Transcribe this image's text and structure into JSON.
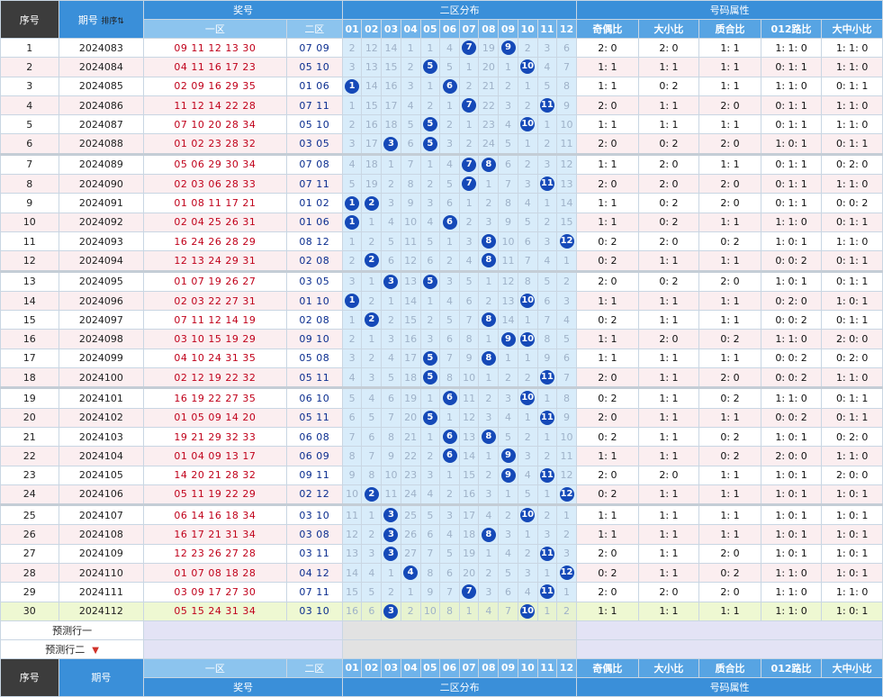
{
  "headers": {
    "seq": "序号",
    "period": "期号",
    "sort_icon_label": "排序",
    "prize": "奖号",
    "zone1": "一区",
    "zone2": "二区",
    "distribution": "二区分布",
    "attributes": "号码属性",
    "cols": [
      "01",
      "02",
      "03",
      "04",
      "05",
      "06",
      "07",
      "08",
      "09",
      "10",
      "11",
      "12"
    ],
    "attr_names": [
      "奇偶比",
      "大小比",
      "质合比",
      "012路比",
      "大中小比"
    ]
  },
  "rows": [
    {
      "seq": "1",
      "period": "2024083",
      "z1": "09 11 12 13 30",
      "z2": "07 09",
      "dist": [
        "2",
        "12",
        "14",
        "1",
        "1",
        "4",
        "07",
        "19",
        "09",
        "2",
        "3",
        "6"
      ],
      "attrs": [
        "2: 0",
        "2: 0",
        "1: 1",
        "1: 1: 0",
        "1: 1: 0"
      ]
    },
    {
      "seq": "2",
      "period": "2024084",
      "z1": "04 11 16 17 23",
      "z2": "05 10",
      "dist": [
        "3",
        "13",
        "15",
        "2",
        "05",
        "5",
        "1",
        "20",
        "1",
        "10",
        "4",
        "7"
      ],
      "attrs": [
        "1: 1",
        "1: 1",
        "1: 1",
        "0: 1: 1",
        "1: 1: 0"
      ]
    },
    {
      "seq": "3",
      "period": "2024085",
      "z1": "02 09 16 29 35",
      "z2": "01 06",
      "dist": [
        "01",
        "14",
        "16",
        "3",
        "1",
        "06",
        "2",
        "21",
        "2",
        "1",
        "5",
        "8"
      ],
      "attrs": [
        "1: 1",
        "0: 2",
        "1: 1",
        "1: 1: 0",
        "0: 1: 1"
      ]
    },
    {
      "seq": "4",
      "period": "2024086",
      "z1": "11 12 14 22 28",
      "z2": "07 11",
      "dist": [
        "1",
        "15",
        "17",
        "4",
        "2",
        "1",
        "07",
        "22",
        "3",
        "2",
        "11",
        "9"
      ],
      "attrs": [
        "2: 0",
        "1: 1",
        "2: 0",
        "0: 1: 1",
        "1: 1: 0"
      ]
    },
    {
      "seq": "5",
      "period": "2024087",
      "z1": "07 10 20 28 34",
      "z2": "05 10",
      "dist": [
        "2",
        "16",
        "18",
        "5",
        "05",
        "2",
        "1",
        "23",
        "4",
        "10",
        "1",
        "10"
      ],
      "attrs": [
        "1: 1",
        "1: 1",
        "1: 1",
        "0: 1: 1",
        "1: 1: 0"
      ]
    },
    {
      "seq": "6",
      "period": "2024088",
      "z1": "01 02 23 28 32",
      "z2": "03 05",
      "dist": [
        "3",
        "17",
        "03",
        "6",
        "05",
        "3",
        "2",
        "24",
        "5",
        "1",
        "2",
        "11"
      ],
      "attrs": [
        "2: 0",
        "0: 2",
        "2: 0",
        "1: 0: 1",
        "0: 1: 1"
      ]
    },
    {
      "seq": "7",
      "period": "2024089",
      "z1": "05 06 29 30 34",
      "z2": "07 08",
      "dist": [
        "4",
        "18",
        "1",
        "7",
        "1",
        "4",
        "07",
        "08",
        "6",
        "2",
        "3",
        "12"
      ],
      "attrs": [
        "1: 1",
        "2: 0",
        "1: 1",
        "0: 1: 1",
        "0: 2: 0"
      ]
    },
    {
      "seq": "8",
      "period": "2024090",
      "z1": "02 03 06 28 33",
      "z2": "07 11",
      "dist": [
        "5",
        "19",
        "2",
        "8",
        "2",
        "5",
        "07",
        "1",
        "7",
        "3",
        "11",
        "13"
      ],
      "attrs": [
        "2: 0",
        "2: 0",
        "2: 0",
        "0: 1: 1",
        "1: 1: 0"
      ]
    },
    {
      "seq": "9",
      "period": "2024091",
      "z1": "01 08 11 17 21",
      "z2": "01 02",
      "dist": [
        "01",
        "02",
        "3",
        "9",
        "3",
        "6",
        "1",
        "2",
        "8",
        "4",
        "1",
        "14"
      ],
      "attrs": [
        "1: 1",
        "0: 2",
        "2: 0",
        "0: 1: 1",
        "0: 0: 2"
      ]
    },
    {
      "seq": "10",
      "period": "2024092",
      "z1": "02 04 25 26 31",
      "z2": "01 06",
      "dist": [
        "01",
        "1",
        "4",
        "10",
        "4",
        "06",
        "2",
        "3",
        "9",
        "5",
        "2",
        "15"
      ],
      "attrs": [
        "1: 1",
        "0: 2",
        "1: 1",
        "1: 1: 0",
        "0: 1: 1"
      ]
    },
    {
      "seq": "11",
      "period": "2024093",
      "z1": "16 24 26 28 29",
      "z2": "08 12",
      "dist": [
        "1",
        "2",
        "5",
        "11",
        "5",
        "1",
        "3",
        "08",
        "10",
        "6",
        "3",
        "12"
      ],
      "attrs": [
        "0: 2",
        "2: 0",
        "0: 2",
        "1: 0: 1",
        "1: 1: 0"
      ]
    },
    {
      "seq": "12",
      "period": "2024094",
      "z1": "12 13 24 29 31",
      "z2": "02 08",
      "dist": [
        "2",
        "02",
        "6",
        "12",
        "6",
        "2",
        "4",
        "08",
        "11",
        "7",
        "4",
        "1"
      ],
      "attrs": [
        "0: 2",
        "1: 1",
        "1: 1",
        "0: 0: 2",
        "0: 1: 1"
      ]
    },
    {
      "seq": "13",
      "period": "2024095",
      "z1": "01 07 19 26 27",
      "z2": "03 05",
      "dist": [
        "3",
        "1",
        "03",
        "13",
        "05",
        "3",
        "5",
        "1",
        "12",
        "8",
        "5",
        "2"
      ],
      "attrs": [
        "2: 0",
        "0: 2",
        "2: 0",
        "1: 0: 1",
        "0: 1: 1"
      ]
    },
    {
      "seq": "14",
      "period": "2024096",
      "z1": "02 03 22 27 31",
      "z2": "01 10",
      "dist": [
        "01",
        "2",
        "1",
        "14",
        "1",
        "4",
        "6",
        "2",
        "13",
        "10",
        "6",
        "3"
      ],
      "attrs": [
        "1: 1",
        "1: 1",
        "1: 1",
        "0: 2: 0",
        "1: 0: 1"
      ]
    },
    {
      "seq": "15",
      "period": "2024097",
      "z1": "07 11 12 14 19",
      "z2": "02 08",
      "dist": [
        "1",
        "02",
        "2",
        "15",
        "2",
        "5",
        "7",
        "08",
        "14",
        "1",
        "7",
        "4"
      ],
      "attrs": [
        "0: 2",
        "1: 1",
        "1: 1",
        "0: 0: 2",
        "0: 1: 1"
      ]
    },
    {
      "seq": "16",
      "period": "2024098",
      "z1": "03 10 15 19 29",
      "z2": "09 10",
      "dist": [
        "2",
        "1",
        "3",
        "16",
        "3",
        "6",
        "8",
        "1",
        "09",
        "10",
        "8",
        "5"
      ],
      "attrs": [
        "1: 1",
        "2: 0",
        "0: 2",
        "1: 1: 0",
        "2: 0: 0"
      ]
    },
    {
      "seq": "17",
      "period": "2024099",
      "z1": "04 10 24 31 35",
      "z2": "05 08",
      "dist": [
        "3",
        "2",
        "4",
        "17",
        "05",
        "7",
        "9",
        "08",
        "1",
        "1",
        "9",
        "6"
      ],
      "attrs": [
        "1: 1",
        "1: 1",
        "1: 1",
        "0: 0: 2",
        "0: 2: 0"
      ]
    },
    {
      "seq": "18",
      "period": "2024100",
      "z1": "02 12 19 22 32",
      "z2": "05 11",
      "dist": [
        "4",
        "3",
        "5",
        "18",
        "05",
        "8",
        "10",
        "1",
        "2",
        "2",
        "11",
        "7"
      ],
      "attrs": [
        "2: 0",
        "1: 1",
        "2: 0",
        "0: 0: 2",
        "1: 1: 0"
      ]
    },
    {
      "seq": "19",
      "period": "2024101",
      "z1": "16 19 22 27 35",
      "z2": "06 10",
      "dist": [
        "5",
        "4",
        "6",
        "19",
        "1",
        "06",
        "11",
        "2",
        "3",
        "10",
        "1",
        "8"
      ],
      "attrs": [
        "0: 2",
        "1: 1",
        "0: 2",
        "1: 1: 0",
        "0: 1: 1"
      ]
    },
    {
      "seq": "20",
      "period": "2024102",
      "z1": "01 05 09 14 20",
      "z2": "05 11",
      "dist": [
        "6",
        "5",
        "7",
        "20",
        "05",
        "1",
        "12",
        "3",
        "4",
        "1",
        "11",
        "9"
      ],
      "attrs": [
        "2: 0",
        "1: 1",
        "1: 1",
        "0: 0: 2",
        "0: 1: 1"
      ]
    },
    {
      "seq": "21",
      "period": "2024103",
      "z1": "19 21 29 32 33",
      "z2": "06 08",
      "dist": [
        "7",
        "6",
        "8",
        "21",
        "1",
        "06",
        "13",
        "08",
        "5",
        "2",
        "1",
        "10"
      ],
      "attrs": [
        "0: 2",
        "1: 1",
        "0: 2",
        "1: 0: 1",
        "0: 2: 0"
      ]
    },
    {
      "seq": "22",
      "period": "2024104",
      "z1": "01 04 09 13 17",
      "z2": "06 09",
      "dist": [
        "8",
        "7",
        "9",
        "22",
        "2",
        "06",
        "14",
        "1",
        "09",
        "3",
        "2",
        "11"
      ],
      "attrs": [
        "1: 1",
        "1: 1",
        "0: 2",
        "2: 0: 0",
        "1: 1: 0"
      ]
    },
    {
      "seq": "23",
      "period": "2024105",
      "z1": "14 20 21 28 32",
      "z2": "09 11",
      "dist": [
        "9",
        "8",
        "10",
        "23",
        "3",
        "1",
        "15",
        "2",
        "09",
        "4",
        "11",
        "12"
      ],
      "attrs": [
        "2: 0",
        "2: 0",
        "1: 1",
        "1: 0: 1",
        "2: 0: 0"
      ]
    },
    {
      "seq": "24",
      "period": "2024106",
      "z1": "05 11 19 22 29",
      "z2": "02 12",
      "dist": [
        "10",
        "02",
        "11",
        "24",
        "4",
        "2",
        "16",
        "3",
        "1",
        "5",
        "1",
        "12"
      ],
      "attrs": [
        "0: 2",
        "1: 1",
        "1: 1",
        "1: 0: 1",
        "1: 0: 1"
      ]
    },
    {
      "seq": "25",
      "period": "2024107",
      "z1": "06 14 16 18 34",
      "z2": "03 10",
      "dist": [
        "11",
        "1",
        "03",
        "25",
        "5",
        "3",
        "17",
        "4",
        "2",
        "10",
        "2",
        "1"
      ],
      "attrs": [
        "1: 1",
        "1: 1",
        "1: 1",
        "1: 0: 1",
        "1: 0: 1"
      ]
    },
    {
      "seq": "26",
      "period": "2024108",
      "z1": "16 17 21 31 34",
      "z2": "03 08",
      "dist": [
        "12",
        "2",
        "03",
        "26",
        "6",
        "4",
        "18",
        "08",
        "3",
        "1",
        "3",
        "2"
      ],
      "attrs": [
        "1: 1",
        "1: 1",
        "1: 1",
        "1: 0: 1",
        "1: 0: 1"
      ]
    },
    {
      "seq": "27",
      "period": "2024109",
      "z1": "12 23 26 27 28",
      "z2": "03 11",
      "dist": [
        "13",
        "3",
        "03",
        "27",
        "7",
        "5",
        "19",
        "1",
        "4",
        "2",
        "11",
        "3"
      ],
      "attrs": [
        "2: 0",
        "1: 1",
        "2: 0",
        "1: 0: 1",
        "1: 0: 1"
      ]
    },
    {
      "seq": "28",
      "period": "2024110",
      "z1": "01 07 08 18 28",
      "z2": "04 12",
      "dist": [
        "14",
        "4",
        "1",
        "04",
        "8",
        "6",
        "20",
        "2",
        "5",
        "3",
        "1",
        "12"
      ],
      "attrs": [
        "0: 2",
        "1: 1",
        "0: 2",
        "1: 1: 0",
        "1: 0: 1"
      ]
    },
    {
      "seq": "29",
      "period": "2024111",
      "z1": "03 09 17 27 30",
      "z2": "07 11",
      "dist": [
        "15",
        "5",
        "2",
        "1",
        "9",
        "7",
        "07",
        "3",
        "6",
        "4",
        "11",
        "1"
      ],
      "attrs": [
        "2: 0",
        "2: 0",
        "2: 0",
        "1: 1: 0",
        "1: 1: 0"
      ]
    },
    {
      "seq": "30",
      "period": "2024112",
      "z1": "05 15 24 31 34",
      "z2": "03 10",
      "dist": [
        "16",
        "6",
        "03",
        "2",
        "10",
        "8",
        "1",
        "4",
        "7",
        "10",
        "1",
        "2"
      ],
      "attrs": [
        "1: 1",
        "1: 1",
        "1: 1",
        "1: 1: 0",
        "1: 0: 1"
      ]
    }
  ],
  "prediction": {
    "row1_label": "预测行一",
    "row2_label": "预测行二"
  },
  "colors": {
    "ball": "#1549b8",
    "zone1_text": "#c0001a",
    "zone2_text": "#0a2d8f",
    "dist_bg": "#d8ecfa",
    "header_dark": "#3c3c3c",
    "header_blue": "#3a8fd9"
  }
}
